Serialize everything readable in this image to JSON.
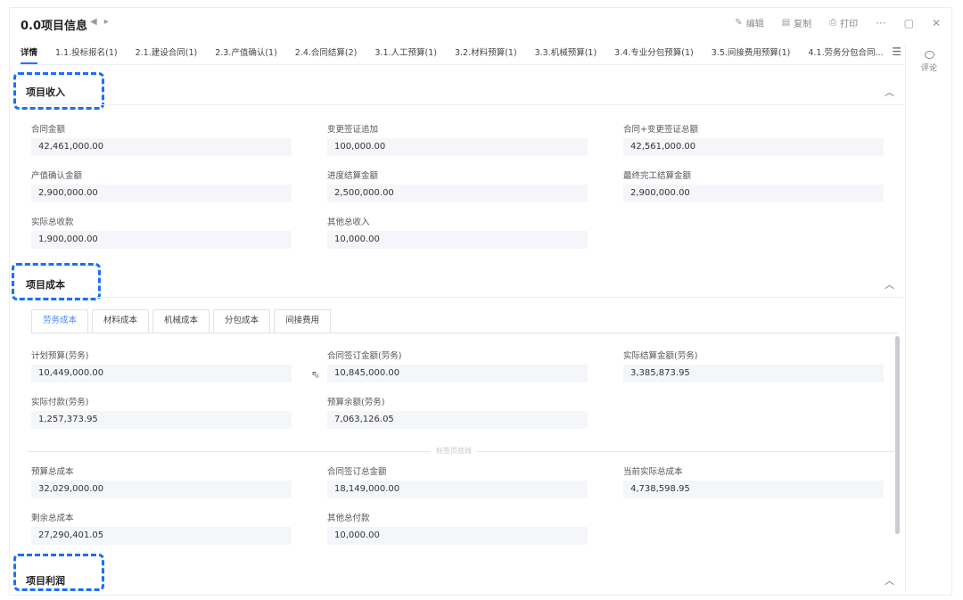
{
  "header": {
    "title": "0.0项目信息",
    "nav_prev": "◀",
    "nav_next": "▸",
    "actions": [
      {
        "icon": "edit-icon",
        "glyph": "✎",
        "label": "编辑"
      },
      {
        "icon": "copy-icon",
        "glyph": "▤",
        "label": "复制"
      },
      {
        "icon": "print-icon",
        "glyph": "⎙",
        "label": "打印"
      }
    ],
    "more": "···",
    "maximize": "▢",
    "close": "✕"
  },
  "tabs": [
    {
      "label": "详情",
      "active": true
    },
    {
      "label": "1.1.投标报名(1)"
    },
    {
      "label": "2.1.建设合同(1)"
    },
    {
      "label": "2.3.产值确认(1)"
    },
    {
      "label": "2.4.合同结算(2)"
    },
    {
      "label": "3.1.人工预算(1)"
    },
    {
      "label": "3.2.材料预算(1)"
    },
    {
      "label": "3.3.机械预算(1)"
    },
    {
      "label": "3.4.专业分包预算(1)"
    },
    {
      "label": "3.5.间接费用预算(1)"
    },
    {
      "label": "4.1.劳务分包合同..."
    }
  ],
  "tab_menu": "☰",
  "rail": {
    "comment_label": "评论",
    "comment_glyph": "···"
  },
  "income": {
    "title": "项目收入",
    "caret": "︿",
    "fields": [
      {
        "label": "合同金额",
        "value": "42,461,000.00"
      },
      {
        "label": "变更签证追加",
        "value": "100,000.00"
      },
      {
        "label": "合同+变更签证总额",
        "value": "42,561,000.00"
      },
      {
        "label": "产值确认金额",
        "value": "2,900,000.00"
      },
      {
        "label": "进度结算金额",
        "value": "2,500,000.00"
      },
      {
        "label": "最终完工结算金额",
        "value": "2,900,000.00"
      },
      {
        "label": "实际总收款",
        "value": "1,900,000.00"
      },
      {
        "label": "其他总收入",
        "value": "10,000.00"
      }
    ]
  },
  "cost": {
    "title": "项目成本",
    "caret": "︿",
    "subtabs": [
      {
        "label": "劳务成本",
        "active": true
      },
      {
        "label": "材料成本"
      },
      {
        "label": "机械成本"
      },
      {
        "label": "分包成本"
      },
      {
        "label": "间接费用"
      }
    ],
    "labor_fields": [
      {
        "label": "计划预算(劳务)",
        "value": "10,449,000.00"
      },
      {
        "label": "合同签订金额(劳务)",
        "value": "10,845,000.00"
      },
      {
        "label": "实际结算金额(劳务)",
        "value": "3,385,873.95"
      },
      {
        "label": "实际付款(劳务)",
        "value": "1,257,373.95"
      },
      {
        "label": "预算余额(劳务)",
        "value": "7,063,126.05"
      }
    ],
    "separator": "标签页底线",
    "summary_fields": [
      {
        "label": "预算总成本",
        "value": "32,029,000.00"
      },
      {
        "label": "合同签订总金额",
        "value": "18,149,000.00"
      },
      {
        "label": "当前实际总成本",
        "value": "4,738,598.95"
      },
      {
        "label": "剩余总成本",
        "value": "27,290,401.05"
      },
      {
        "label": "其他总付款",
        "value": "10,000.00"
      }
    ]
  },
  "profit": {
    "title": "项目利润",
    "caret": "︿"
  },
  "colors": {
    "accent": "#2f6bff",
    "highlight_box": "#1a6dff",
    "field_bg": "#f4f6f9"
  }
}
